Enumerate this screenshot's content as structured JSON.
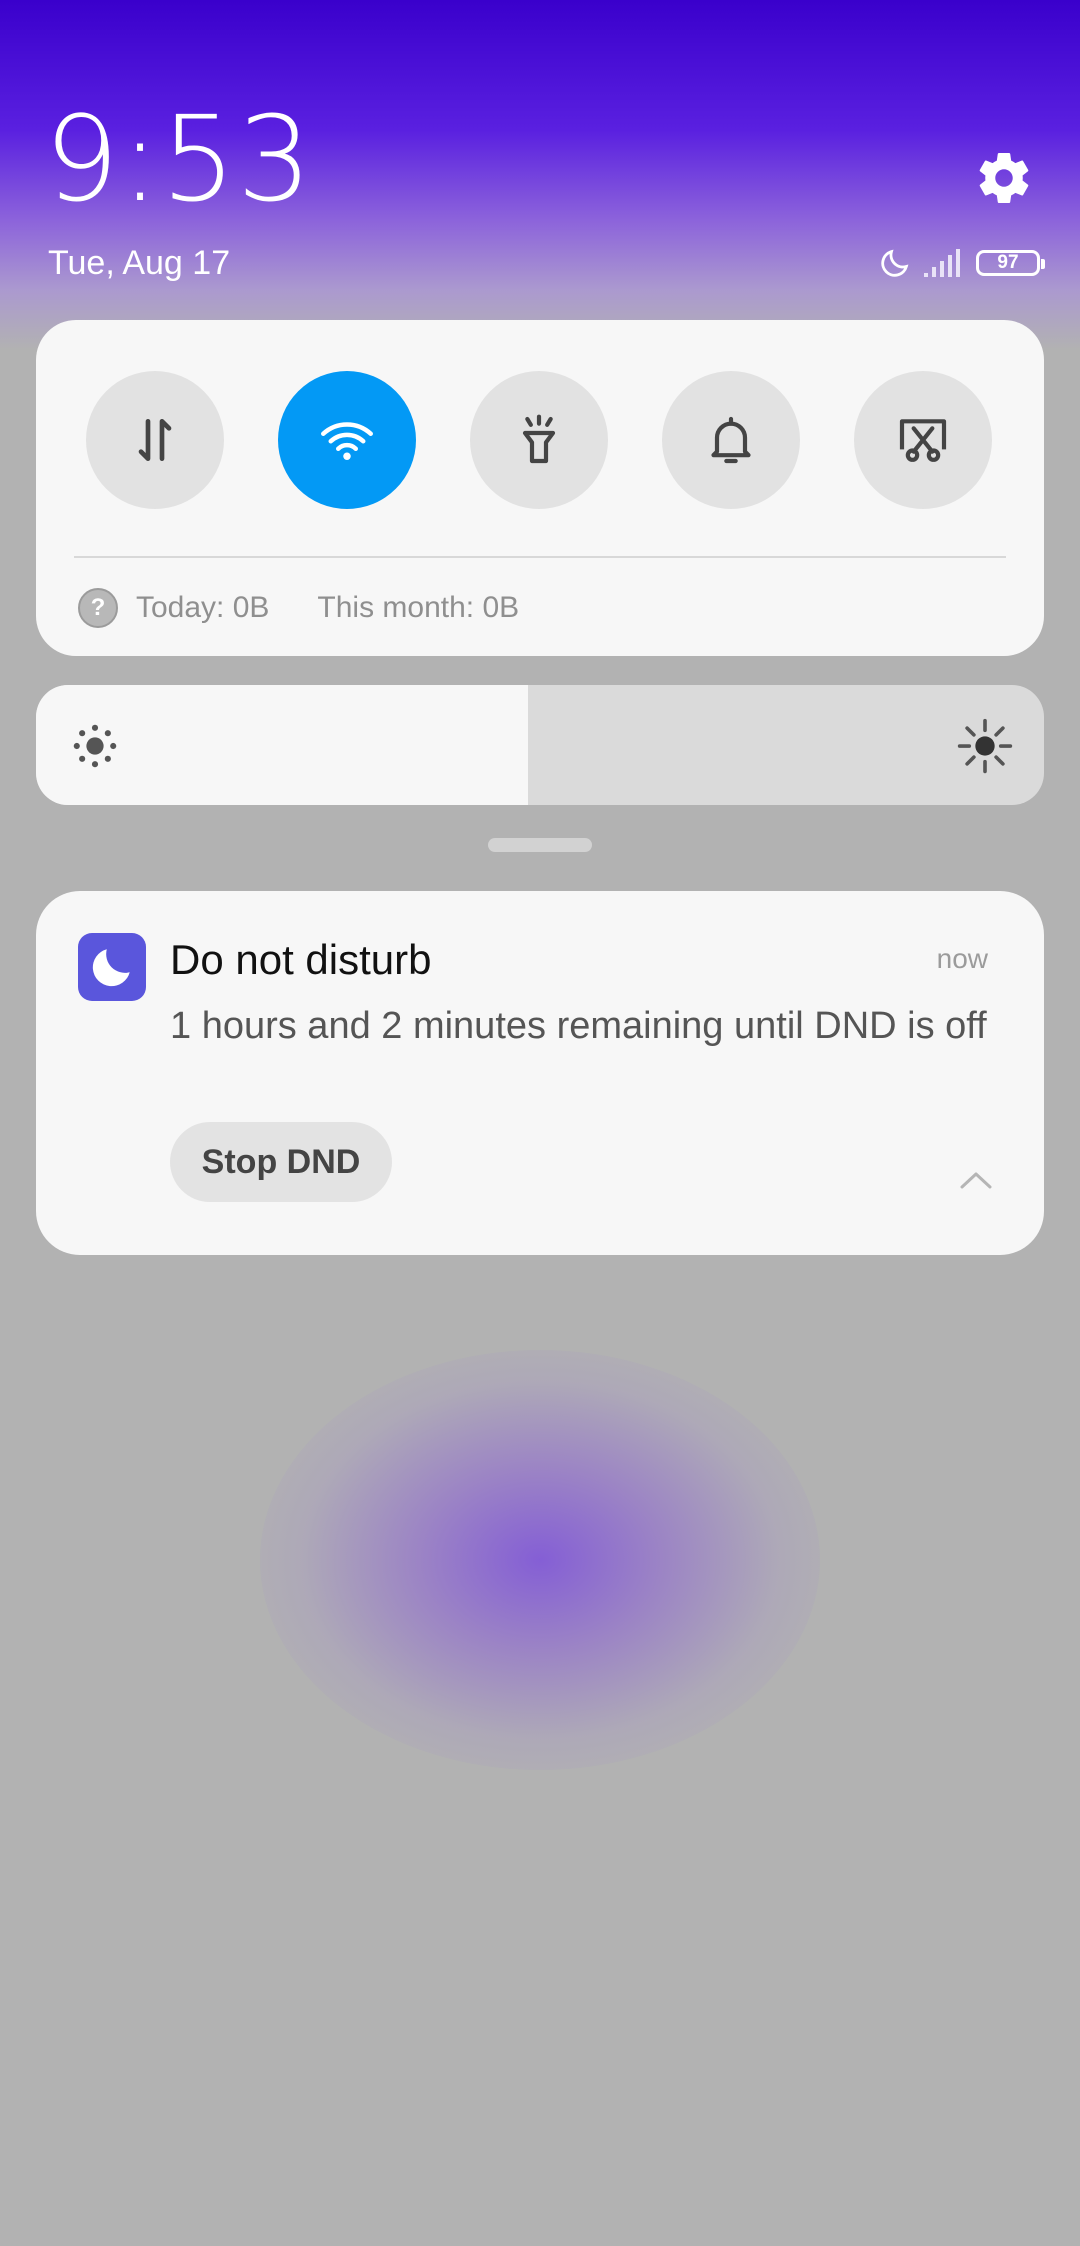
{
  "status_bar": {
    "time": "9:53",
    "date": "Tue, Aug 17",
    "battery_level": "97",
    "icons": [
      "moon-icon",
      "signal-icon",
      "battery-icon",
      "gear-icon"
    ]
  },
  "quick_settings": {
    "toggles": [
      {
        "name": "mobile-data",
        "icon": "data-arrows-icon",
        "active": false
      },
      {
        "name": "wifi",
        "icon": "wifi-icon",
        "active": true
      },
      {
        "name": "flashlight",
        "icon": "flashlight-icon",
        "active": false
      },
      {
        "name": "sound",
        "icon": "bell-icon",
        "active": false
      },
      {
        "name": "screenshot",
        "icon": "scissors-icon",
        "active": false
      }
    ],
    "data_usage": {
      "today": "Today: 0B",
      "month": "This month: 0B",
      "help_glyph": "?"
    }
  },
  "brightness": {
    "level": 0.488
  },
  "notification": {
    "title": "Do not disturb",
    "time": "now",
    "body": "1 hours and 2 minutes remaining until DND is off",
    "action_label": "Stop DND",
    "app_icon": "moon-icon"
  },
  "colors": {
    "accent": "#0399f5",
    "dnd_icon": "#5a56dc",
    "header_top": "#3a00cc"
  }
}
